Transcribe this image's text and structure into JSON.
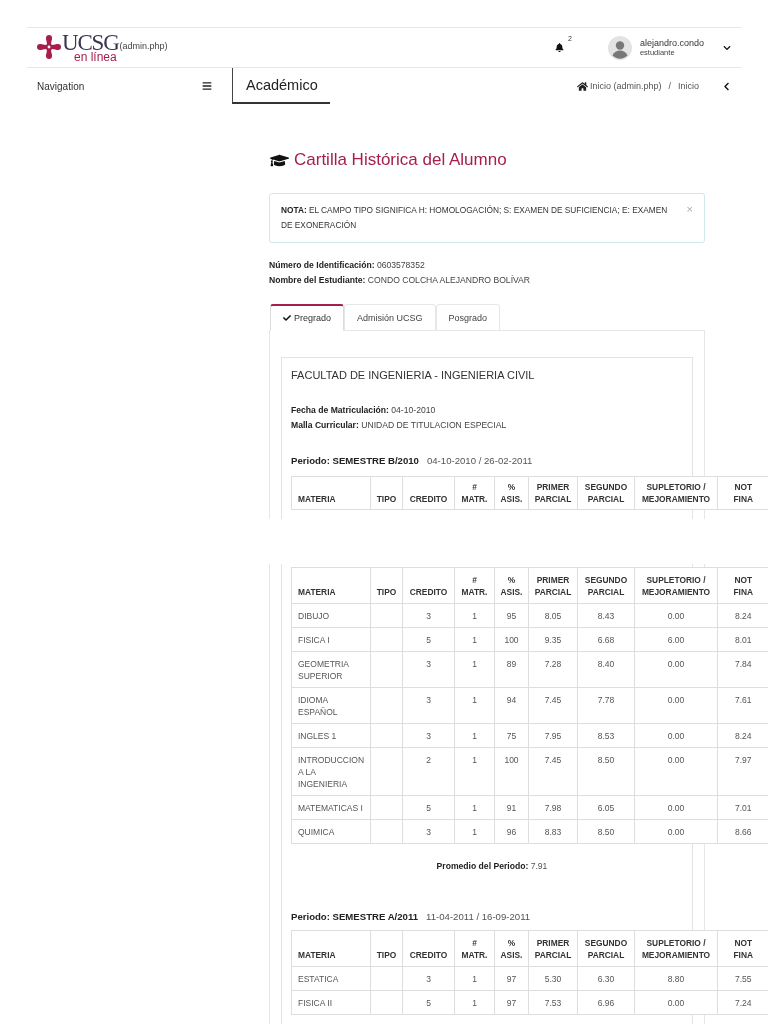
{
  "header": {
    "logo": {
      "wordmark": "UCSG",
      "tagline": "en línea"
    },
    "logo_link": "(admin.php)",
    "notifications": {
      "count": "2"
    },
    "user": {
      "name": "alejandro.condo",
      "role": "estudiante"
    }
  },
  "subheader": {
    "navigation": "Navigation",
    "section": "Académico",
    "breadcrumb": [
      "Inicio (admin.php)",
      "Inicio"
    ],
    "breadcrumb_separator": "/"
  },
  "title": "Cartilla Histórica del Alumno",
  "note": {
    "text": "**NOTA:** EL CAMPO TIPO SIGNIFICA H: HOMOLOGACIÓN; S: EXAMEN DE SUFICIENCIA; E: EXAMEN DE EXONERACIÓN",
    "close": "×"
  },
  "student": [
    "**Número de Identificación:** 0603578352",
    "**Nombre del Estudiante:** CONDO COLCHA ALEJANDRO BOLÍVAR"
  ],
  "tabs": [
    {
      "label": "Pregrado",
      "selected": true
    },
    {
      "label": "Admisión UCSG",
      "selected": false
    },
    {
      "label": "Posgrado",
      "selected": false
    }
  ],
  "program": {
    "name": "FACULTAD DE INGENIERIA - INGENIERIA CIVIL",
    "details": [
      "**Fecha de Matriculación:** 04-10-2010",
      "**Malla Curricular:** UNIDAD DE TITULACION ESPECIAL"
    ],
    "periods": [
      {
        "title": "Periodo: SEMESTRE B/2010",
        "dates": "04-10-2010 / 26-02-2011",
        "columns": [
          "MATERIA",
          "TIPO",
          "CREDITO",
          "#\nMATR.",
          "%\nASIS.",
          "PRIMER\nPARCIAL",
          "SEGUNDO\nPARCIAL",
          "SUPLETORIO /\nMEJORAMIENTO",
          "NOT\nFINA"
        ]
      }
    ]
  },
  "continued_page": {
    "table": {
      "columns": [
        "MATERIA",
        "TIPO",
        "CREDITO",
        "#\nMATR.",
        "%\nASIS.",
        "PRIMER\nPARCIAL",
        "SEGUNDO\nPARCIAL",
        "SUPLETORIO /\nMEJORAMIENTO",
        "NOT\nFINA"
      ],
      "rows": [
        {
          "materia": "DIBUJO",
          "credito": "3",
          "matr": "1",
          "asis": "95",
          "primer_parcial": "8.05",
          "segundo_parcial": "8.43",
          "supletorio": "0.00",
          "column_9": "8.24"
        },
        {
          "materia": "FISICA I",
          "credito": "5",
          "matr": "1",
          "asis": "100",
          "primer_parcial": "9.35",
          "segundo_parcial": "6.68",
          "supletorio": "6.00",
          "column_9": "8.01"
        },
        {
          "materia": "GEOMETRIA SUPERIOR",
          "credito": "3",
          "matr": "1",
          "asis": "89",
          "primer_parcial": "7.28",
          "segundo_parcial": "8.40",
          "supletorio": "0.00",
          "column_9": "7.84"
        },
        {
          "materia": "IDIOMA ESPAÑOL",
          "credito": "3",
          "matr": "1",
          "asis": "94",
          "primer_parcial": "7.45",
          "segundo_parcial": "7.78",
          "supletorio": "0.00",
          "column_9": "7.61"
        },
        {
          "materia": "INGLES 1",
          "credito": "3",
          "matr": "1",
          "asis": "75",
          "primer_parcial": "7.95",
          "segundo_parcial": "8.53",
          "supletorio": "0.00",
          "column_9": "8.24"
        },
        {
          "materia": "INTRODUCCION A LA INGENIERIA",
          "credito": "2",
          "matr": "1",
          "asis": "100",
          "primer_parcial": "7.45",
          "segundo_parcial": "8.50",
          "supletorio": "0.00",
          "column_9": "7.97"
        },
        {
          "materia": "MATEMATICAS I",
          "credito": "5",
          "matr": "1",
          "asis": "91",
          "primer_parcial": "7.98",
          "segundo_parcial": "6.05",
          "supletorio": "0.00",
          "column_9": "7.01"
        },
        {
          "materia": "QUIMICA",
          "credito": "3",
          "matr": "1",
          "asis": "96",
          "primer_parcial": "8.83",
          "segundo_parcial": "8.50",
          "supletorio": "0.00",
          "column_9": "8.66"
        }
      ]
    },
    "average": "**Promedio del Periodo:** 7.91",
    "periods": [
      {
        "title": "Periodo: SEMESTRE A/2011",
        "dates": "11-04-2011 / 16-09-2011",
        "table": {
          "columns": [
            "MATERIA",
            "TIPO",
            "CREDITO",
            "#\nMATR.",
            "%\nASIS.",
            "PRIMER\nPARCIAL",
            "SEGUNDO\nPARCIAL",
            "SUPLETORIO /\nMEJORAMIENTO",
            "NOT\nFINA"
          ],
          "rows": [
            {
              "materia": "ESTATICA",
              "credito": "3",
              "matr": "1",
              "asis": "97",
              "primer_parcial": "5.30",
              "segundo_parcial": "6.30",
              "supletorio": "8.80",
              "column_9": "7.55"
            },
            {
              "materia": "FISICA II",
              "credito": "5",
              "matr": "1",
              "asis": "97",
              "primer_parcial": "7.53",
              "segundo_parcial": "6.96",
              "supletorio": "0.00",
              "column_9": "7.24"
            }
          ]
        }
      }
    ]
  }
}
